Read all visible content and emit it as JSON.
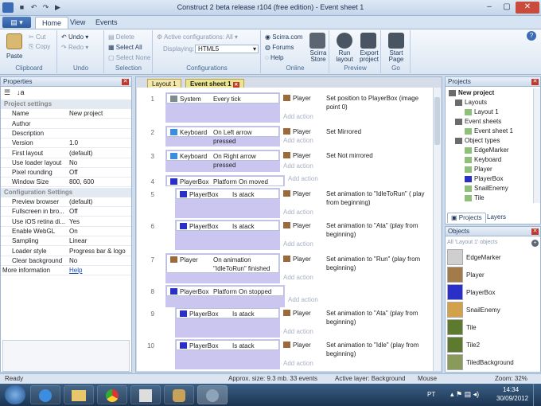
{
  "window": {
    "title": "Construct 2 beta release r104  (free edition) - Event sheet 1"
  },
  "ribbon": {
    "tabs": [
      "Home",
      "View",
      "Events"
    ],
    "clipboard": {
      "paste": "Paste",
      "cut": "Cut",
      "copy": "Copy",
      "label": "Clipboard"
    },
    "undo": {
      "undo": "Undo",
      "redo": "Redo",
      "label": "Undo"
    },
    "selection": {
      "delete": "Delete",
      "select_all": "Select All",
      "select_none": "Select None",
      "label": "Selection"
    },
    "configurations": {
      "active": "Active configurations: All",
      "displaying_label": "Displaying:",
      "displaying_value": "HTML5",
      "label": "Configurations"
    },
    "online": {
      "scirra": "Scirra.com",
      "forums": "Forums",
      "help": "Help",
      "store": "Scirra Store",
      "label": "Online"
    },
    "preview": {
      "run": "Run layout",
      "export": "Export project",
      "label": "Preview"
    },
    "go": {
      "start": "Start Page",
      "label": "Go"
    }
  },
  "properties": {
    "title": "Properties",
    "rows": [
      {
        "type": "section",
        "k": "Project settings"
      },
      {
        "k": "Name",
        "v": "New project"
      },
      {
        "k": "Author",
        "v": ""
      },
      {
        "k": "Description",
        "v": ""
      },
      {
        "k": "Version",
        "v": "1.0"
      },
      {
        "k": "First layout",
        "v": "(default)"
      },
      {
        "k": "Use loader layout",
        "v": "No"
      },
      {
        "k": "Pixel rounding",
        "v": "Off"
      },
      {
        "k": "Window Size",
        "v": "800, 600"
      },
      {
        "type": "section",
        "k": "Configuration Settings"
      },
      {
        "k": "Preview browser",
        "v": "(default)"
      },
      {
        "k": "Fullscreen in bro...",
        "v": "Off"
      },
      {
        "k": "Use iOS retina di...",
        "v": "Yes"
      },
      {
        "k": "Enable WebGL",
        "v": "On"
      },
      {
        "k": "Sampling",
        "v": "Linear"
      },
      {
        "k": "Loader style",
        "v": "Progress bar & logo"
      },
      {
        "k": "Clear background",
        "v": "No"
      },
      {
        "k": "More information",
        "v": "Help"
      }
    ]
  },
  "editor": {
    "tabs": [
      "Layout 1",
      "Event sheet 1"
    ],
    "add_action": "Add action",
    "events": [
      {
        "num": "1",
        "obj": "System",
        "cond": "Every tick",
        "aobj": "Player",
        "act": "Set position to  PlayerBox (image point 0)"
      },
      {
        "num": "2",
        "obj": "Keyboard",
        "cond": "On Left arrow pressed",
        "aobj": "Player",
        "act": "Set Mirrored"
      },
      {
        "num": "3",
        "obj": "Keyboard",
        "cond": "On Right arrow pressed",
        "aobj": "Player",
        "act": "Set Not mirrored"
      },
      {
        "num": "4",
        "obj": "PlayerBox",
        "cond": "Platform On moved",
        "aobj": "",
        "act": ""
      },
      {
        "num": "5",
        "obj": "PlayerBox",
        "cond": "Is atack",
        "aobj": "Player",
        "act": "Set animation to \"IdleToRun\" ( play from beginning)"
      },
      {
        "num": "6",
        "obj": "PlayerBox",
        "cond": "Is atack",
        "aobj": "Player",
        "act": "Set animation to \"Ata\" (play from beginning)"
      },
      {
        "num": "7",
        "obj": "Player",
        "cond": "On animation \"IdleToRun\" finished",
        "aobj": "Player",
        "act": "Set animation to \"Run\" (play from beginning)"
      },
      {
        "num": "8",
        "obj": "PlayerBox",
        "cond": "Platform On stopped",
        "aobj": "",
        "act": ""
      },
      {
        "num": "9",
        "obj": "PlayerBox",
        "cond": "Is atack",
        "aobj": "Player",
        "act": "Set animation to \"Ata\" (play from beginning)"
      },
      {
        "num": "10",
        "obj": "PlayerBox",
        "cond": "Is atack",
        "aobj": "Player",
        "act": "Set animation to \"Idle\" (play from beginning)"
      }
    ]
  },
  "projects": {
    "title": "Projects",
    "tree": [
      "New project",
      "Layouts",
      "Layout 1",
      "Event sheets",
      "Event sheet 1",
      "Object types",
      "EdgeMarker",
      "Keyboard",
      "Player",
      "PlayerBox",
      "SnailEnemy",
      "Tile"
    ],
    "tabs": [
      "Projects",
      "Layers"
    ]
  },
  "objects": {
    "title": "Objects",
    "filter": "All 'Layout 1' objects",
    "items": [
      "EdgeMarker",
      "Player",
      "PlayerBox",
      "SnailEnemy",
      "Tile",
      "Tile2",
      "TiledBackground"
    ]
  },
  "status": {
    "ready": "Ready",
    "size": "Approx. size: 9.3 mb. 33 events",
    "layer": "Active layer: Background",
    "mouse": "Mouse",
    "zoom": "Zoom: 32%"
  },
  "taskbar": {
    "lang": "PT",
    "time": "14:34",
    "date": "30/09/2012"
  }
}
